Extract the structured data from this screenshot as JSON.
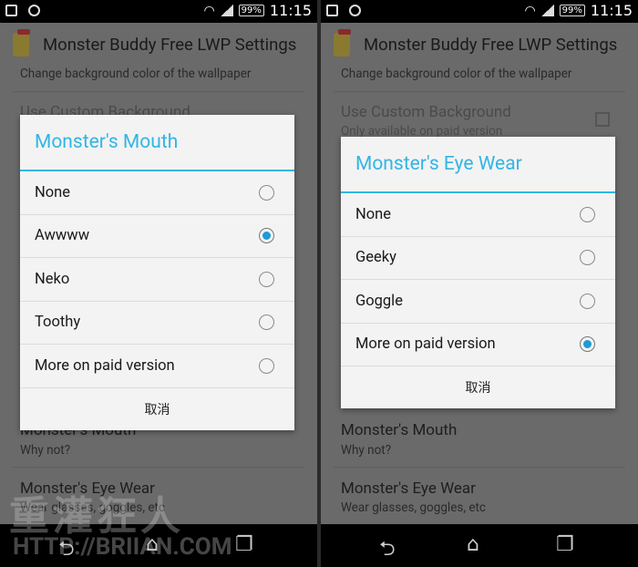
{
  "status": {
    "battery": "99%",
    "time": "11:15"
  },
  "app_title": "Monster Buddy Free LWP Settings",
  "settings": {
    "bg_color_summary": "Change background color of the wallpaper",
    "custom_bg_title": "Use Custom Background",
    "custom_bg_summary": "Only available on paid version",
    "mouth_title": "Monster's Mouth",
    "mouth_summary": "Why not?",
    "eyewear_title": "Monster's Eye Wear",
    "eyewear_summary": "Wear glasses, goggles, etc"
  },
  "dialog_mouth": {
    "title": "Monster's Mouth",
    "options": [
      {
        "label": "None",
        "selected": false
      },
      {
        "label": "Awwww",
        "selected": true
      },
      {
        "label": "Neko",
        "selected": false
      },
      {
        "label": "Toothy",
        "selected": false
      },
      {
        "label": "More on paid version",
        "selected": false
      }
    ],
    "cancel": "取消"
  },
  "dialog_eyewear": {
    "title": "Monster's Eye Wear",
    "options": [
      {
        "label": "None",
        "selected": false
      },
      {
        "label": "Geeky",
        "selected": false
      },
      {
        "label": "Goggle",
        "selected": false
      },
      {
        "label": "More on paid version",
        "selected": true
      }
    ],
    "cancel": "取消"
  },
  "watermark": {
    "line1": "重灌狂人",
    "line2": "HTTP://BRIIAN.COM"
  },
  "accent": "#33b5e5"
}
